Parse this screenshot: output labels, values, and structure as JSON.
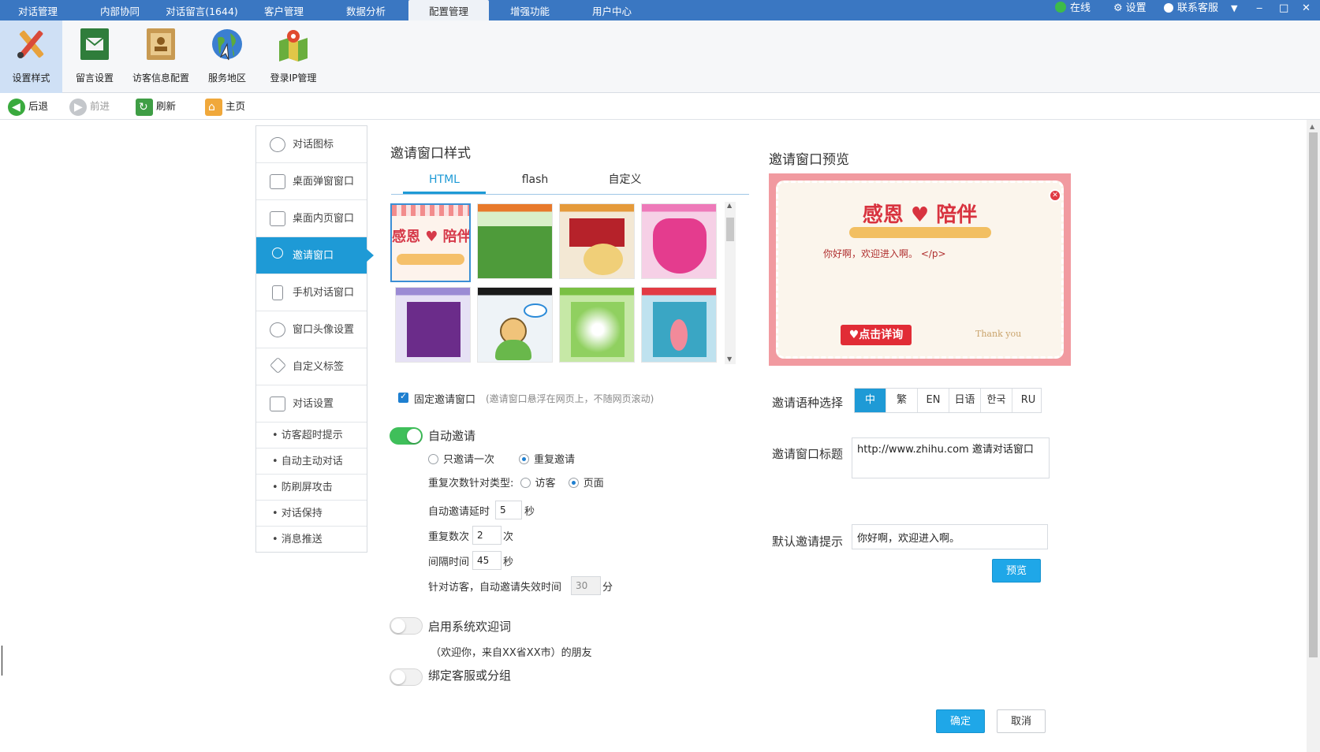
{
  "topbar": {
    "tabs": [
      "对话管理",
      "内部协同",
      "对话留言(1644)",
      "客户管理",
      "数据分析",
      "配置管理",
      "增强功能",
      "用户中心"
    ],
    "active_tab": "配置管理",
    "status": "在线",
    "settings": "设置",
    "contact": "联系客服"
  },
  "ribbon": {
    "items": [
      "设置样式",
      "留言设置",
      "访客信息配置",
      "服务地区",
      "登录IP管理"
    ]
  },
  "navbar": {
    "back": "后退",
    "forward": "前进",
    "refresh": "刷新",
    "home": "主页"
  },
  "sidebar": {
    "items": [
      "对话图标",
      "桌面弹窗窗口",
      "桌面内页窗口",
      "邀请窗口",
      "手机对话窗口",
      "窗口头像设置",
      "自定义标签",
      "对话设置"
    ],
    "active": "邀请窗口",
    "subitems": [
      "• 访客超时提示",
      "• 自动主动对话",
      "• 防刷屏攻击",
      "• 对话保持",
      "• 消息推送"
    ]
  },
  "style_section": {
    "title": "邀请窗口样式",
    "tabs": [
      "HTML",
      "flash",
      "自定义"
    ],
    "active_tab": "HTML",
    "thumb_text": "感恩 ♥ 陪伴"
  },
  "options": {
    "fixed_label": "固定邀请窗口",
    "fixed_hint": "(邀请窗口悬浮在网页上，不随网页滚动)",
    "auto_invite": "自动邀请",
    "invite_once": "只邀请一次",
    "invite_repeat": "重复邀请",
    "repeat_type_label": "重复次数针对类型:",
    "type_visitor": "访客",
    "type_page": "页面",
    "delay_label": "自动邀请延时",
    "delay_value": "5",
    "delay_unit": "秒",
    "repeat_label": "重复数次",
    "repeat_value": "2",
    "repeat_unit": "次",
    "interval_label": "间隔时间",
    "interval_value": "45",
    "interval_unit": "秒",
    "expire_label": "针对访客，自动邀请失效时间",
    "expire_value": "30",
    "expire_unit": "分",
    "welcome_label": "启用系统欢迎词",
    "welcome_hint": "（欢迎你，来自XX省XX市）的朋友",
    "bind_label": "绑定客服或分组"
  },
  "preview": {
    "title": "邀请窗口预览",
    "banner": "感恩 ♥ 陪伴",
    "greeting": "你好啊，欢迎进入啊。 </p>",
    "detail_button": "点击详询",
    "thank_you": "Thank you"
  },
  "settings": {
    "lang_label": "邀请语种选择",
    "langs": [
      "中",
      "繁",
      "EN",
      "日语",
      "한국",
      "RU"
    ],
    "active_lang": "中",
    "title_label": "邀请窗口标题",
    "title_value": "http://www.zhihu.com  邀请对话窗口",
    "hint_label": "默认邀请提示",
    "hint_value": "你好啊，欢迎进入啊。",
    "preview_button": "预览",
    "confirm_button": "确定",
    "cancel_button": "取消"
  },
  "colors": {
    "accent": "#1e9ad6",
    "topbar": "#3a77c2",
    "toggle_on": "#3fbf5a"
  }
}
